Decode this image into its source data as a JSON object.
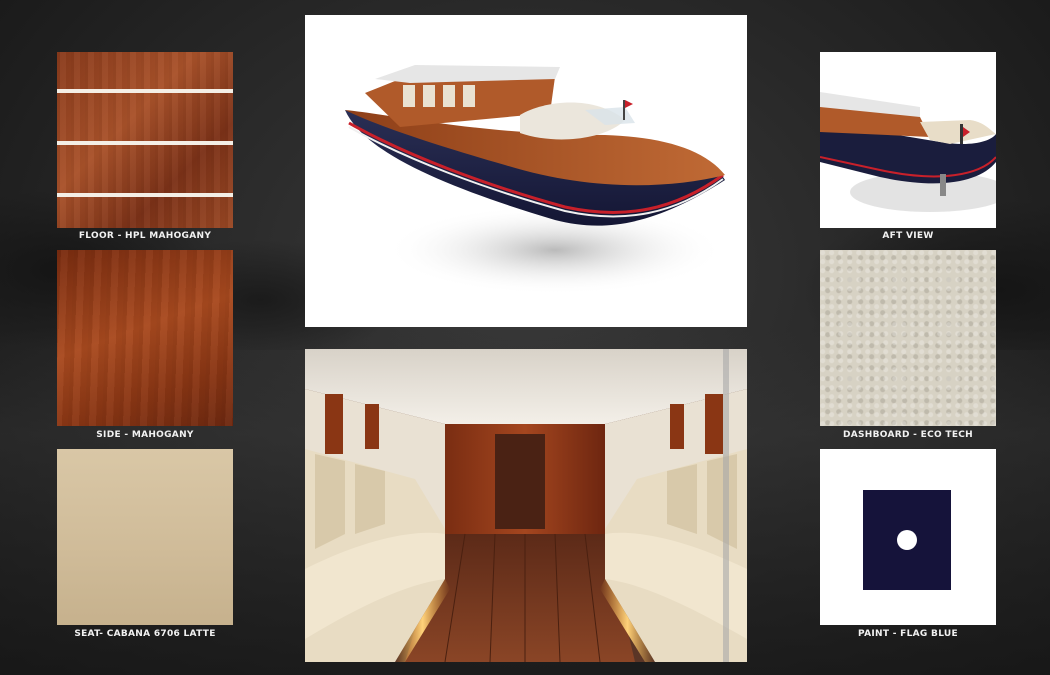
{
  "swatches": {
    "floor": {
      "caption": "FLOOR - HPL MAHOGANY",
      "color": "#9a4824"
    },
    "side": {
      "caption": "SIDE - MAHOGANY",
      "color": "#8a3614"
    },
    "seat": {
      "caption": "SEAT- CABANA 6706 LATTE",
      "color": "#cfbb98"
    },
    "aft": {
      "caption": "AFT VIEW"
    },
    "dashboard": {
      "caption": "DASHBOARD - ECO TECH",
      "color": "#d7d2c4"
    },
    "paint": {
      "caption": "PAINT - FLAG BLUE",
      "color": "#15133a"
    }
  },
  "images": {
    "boat_render": {
      "icon": "boat-render-image"
    },
    "interior_render": {
      "icon": "cabin-interior-image"
    }
  }
}
